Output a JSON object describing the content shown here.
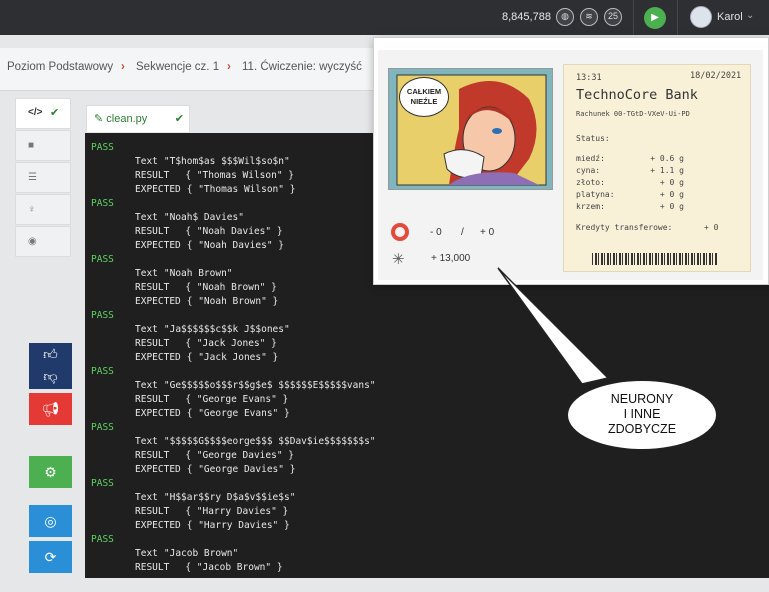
{
  "topbar": {
    "score": "8,845,788",
    "badge_count": "25",
    "username": "Karol",
    "icons": [
      "globe-icon",
      "layers-icon",
      "badge-icon",
      "play-icon",
      "chevron-down-icon"
    ]
  },
  "breadcrumb": {
    "items": [
      "Poziom Podstawowy",
      "Sekwencje cz. 1",
      "11. Ćwiczenie: wyczyść"
    ],
    "separator": "›"
  },
  "editor": {
    "code_tab_label": "</>",
    "file_name": "clean.py",
    "tab_icons": [
      "code-icon",
      "video-icon",
      "list-icon",
      "lightbulb-icon",
      "eye-icon"
    ]
  },
  "console": {
    "labels": {
      "text": "Text",
      "result": "RESULT",
      "expected": "EXPECTED",
      "pass": "PASS"
    },
    "cases": [
      {
        "status": "PASS",
        "text": "\"T$hom$as $$$Wil$so$n\"",
        "result": "{ \"Thomas Wilson\" }",
        "expected": "{ \"Thomas Wilson\" }"
      },
      {
        "status": "PASS",
        "text": "\"Noah$ Davies\"",
        "result": "{ \"Noah Davies\" }",
        "expected": "{ \"Noah Davies\" }"
      },
      {
        "status": "PASS",
        "text": "\"Noah Brown\"",
        "result": "{ \"Noah Brown\" }",
        "expected": "{ \"Noah Brown\" }"
      },
      {
        "status": "PASS",
        "text": "\"Ja$$$$$$c$$k J$$ones\"",
        "result": "{ \"Jack Jones\" }",
        "expected": "{ \"Jack Jones\" }"
      },
      {
        "status": "PASS",
        "text": "\"Ge$$$$$o$$$r$$g$e$ $$$$$$E$$$$$vans\"",
        "result": "{ \"George Evans\" }",
        "expected": "{ \"George Evans\" }"
      },
      {
        "status": "PASS",
        "text": "\"$$$$$G$$$$eorge$$$ $$Dav$ie$$$$$$$s\"",
        "result": "{ \"George Davies\" }",
        "expected": "{ \"George Davies\" }"
      },
      {
        "status": "PASS",
        "text": "\"H$$ar$$ry D$a$v$$ie$s\"",
        "result": "{ \"Harry Davies\" }",
        "expected": "{ \"Harry Davies\" }"
      },
      {
        "status": "PASS",
        "text": "\"Jacob Brown\"",
        "result": "{ \"Jacob Brown\" }",
        "expected": ""
      }
    ]
  },
  "popup": {
    "comic_text": "CAŁKIEM NIEŹLE",
    "lifebuoy_value_1": "- 0",
    "lifebuoy_slash": "/",
    "lifebuoy_value_2": "+ 0",
    "neurons_value": "+ 13,000",
    "bank": {
      "time": "13:31",
      "date": "18/02/2021",
      "name": "TechnoCore Bank",
      "account": "Rachunek 00-TGtD-VXeV-Ui-PD",
      "status_label": "Status:",
      "metals": [
        {
          "name": "miedź:",
          "value": "+ 0.6 g"
        },
        {
          "name": "cyna:",
          "value": "+ 1.1 g"
        },
        {
          "name": "złoto:",
          "value": "+ 0 g"
        },
        {
          "name": "platyna:",
          "value": "+ 0 g"
        },
        {
          "name": "krzem:",
          "value": "+ 0 g"
        }
      ],
      "credits_label": "Kredyty transferowe:",
      "credits_value": "+ 0"
    }
  },
  "callout": {
    "line1": "NEURONY",
    "line2": "I INNE",
    "line3": "ZDOBYCZE"
  },
  "colors": {
    "topbar": "#2d2f33",
    "console_bg": "#1f1f1f",
    "pass": "#5fd35f",
    "green": "#4caf50",
    "red": "#e53935",
    "navy": "#1f3a6b",
    "blue": "#2a8fd6"
  }
}
